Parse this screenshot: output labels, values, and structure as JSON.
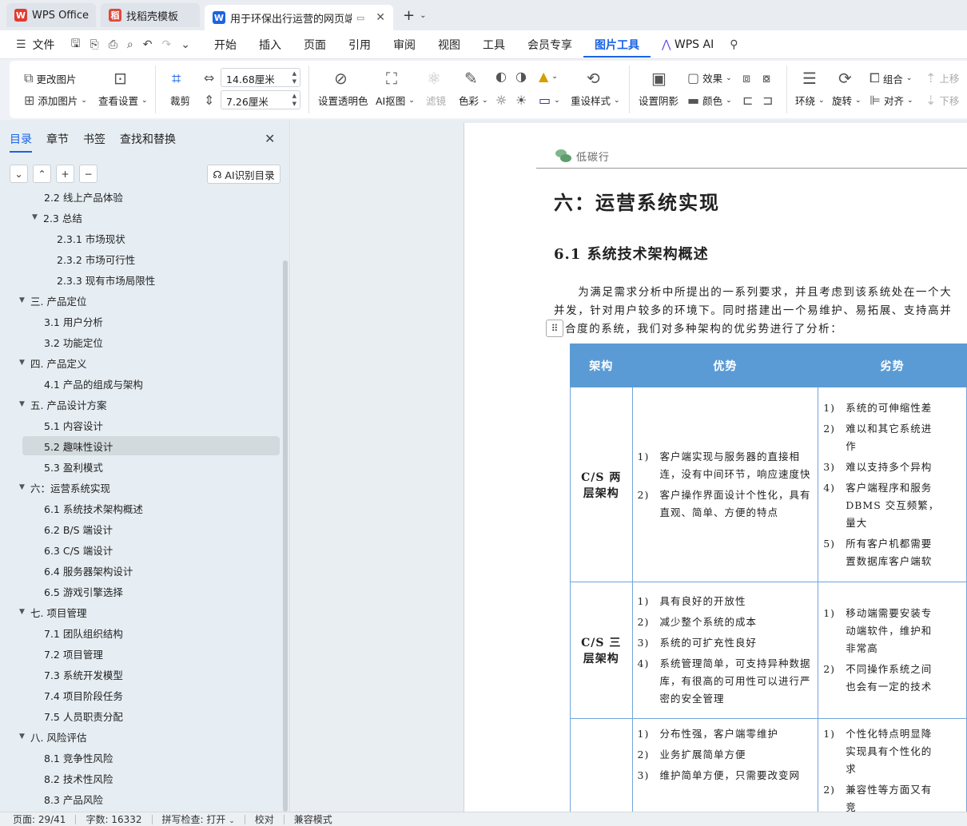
{
  "tabs": [
    {
      "label": "WPS Office",
      "logo": "W",
      "color": "#e03c31"
    },
    {
      "label": "找稻壳模板",
      "logo": "稻",
      "color": "#e0483a"
    },
    {
      "label": "用于环保出行运营的网页端系",
      "logo": "W",
      "color": "#1a63e6"
    }
  ],
  "menu": {
    "file": "文件",
    "items": [
      "开始",
      "插入",
      "页面",
      "引用",
      "审阅",
      "视图",
      "工具",
      "会员专享"
    ],
    "active": "图片工具",
    "ai": "WPS AI"
  },
  "ribbon": {
    "change_image": "更改图片",
    "add_image": "添加图片",
    "view_settings": "查看设置",
    "crop": "裁剪",
    "width": "14.68厘米",
    "height": "7.26厘米",
    "set_transparent": "设置透明色",
    "ai_cutout": "AI抠图",
    "filter": "滤镜",
    "color": "色彩",
    "reset_style": "重设样式",
    "set_shadow": "设置阴影",
    "effect": "效果",
    "fill_color": "颜色",
    "wrap": "环绕",
    "rotate": "旋转",
    "group": "组合",
    "align": "对齐",
    "move_up": "上移",
    "move_down": "下移"
  },
  "sidebar": {
    "tabs": [
      "目录",
      "章节",
      "书签",
      "查找和替换"
    ],
    "ai_button": "AI识别目录",
    "toc": [
      {
        "label": "2.2  线上产品体验",
        "level": 2,
        "arrow": false
      },
      {
        "label": "2.3  总结",
        "level": 2,
        "arrow": true
      },
      {
        "label": "2.3.1  市场现状",
        "level": 3,
        "arrow": false
      },
      {
        "label": "2.3.2  市场可行性",
        "level": 3,
        "arrow": false
      },
      {
        "label": "2.3.3  现有市场局限性",
        "level": 3,
        "arrow": false
      },
      {
        "label": "三. 产品定位",
        "level": 1,
        "arrow": true
      },
      {
        "label": "3.1  用户分析",
        "level": 2,
        "arrow": false
      },
      {
        "label": "3.2  功能定位",
        "level": 2,
        "arrow": false
      },
      {
        "label": "四. 产品定义",
        "level": 1,
        "arrow": true
      },
      {
        "label": "4.1  产品的组成与架构",
        "level": 2,
        "arrow": false
      },
      {
        "label": "五. 产品设计方案",
        "level": 1,
        "arrow": true
      },
      {
        "label": "5.1 内容设计",
        "level": 2,
        "arrow": false
      },
      {
        "label": "5.2  趣味性设计",
        "level": 2,
        "arrow": false,
        "selected": true
      },
      {
        "label": "5.3  盈利模式",
        "level": 2,
        "arrow": false
      },
      {
        "label": "六：运营系统实现",
        "level": 1,
        "arrow": true
      },
      {
        "label": "6.1  系统技术架构概述",
        "level": 2,
        "arrow": false
      },
      {
        "label": "6.2 B/S 端设计",
        "level": 2,
        "arrow": false
      },
      {
        "label": "6.3 C/S 端设计",
        "level": 2,
        "arrow": false
      },
      {
        "label": "6.4 服务器架构设计",
        "level": 2,
        "arrow": false
      },
      {
        "label": "6.5 游戏引擎选择",
        "level": 2,
        "arrow": false
      },
      {
        "label": "七. 项目管理",
        "level": 1,
        "arrow": true
      },
      {
        "label": "7.1  团队组织结构",
        "level": 2,
        "arrow": false
      },
      {
        "label": "7.2  项目管理",
        "level": 2,
        "arrow": false
      },
      {
        "label": "7.3  系统开发模型",
        "level": 2,
        "arrow": false
      },
      {
        "label": "7.4  项目阶段任务",
        "level": 2,
        "arrow": false
      },
      {
        "label": "7.5  人员职责分配",
        "level": 2,
        "arrow": false
      },
      {
        "label": "八. 风险评估",
        "level": 1,
        "arrow": true
      },
      {
        "label": "8.1  竞争性风险",
        "level": 2,
        "arrow": false
      },
      {
        "label": "8.2  技术性风险",
        "level": 2,
        "arrow": false
      },
      {
        "label": "8.3  产品风险",
        "level": 2,
        "arrow": false
      }
    ]
  },
  "doc": {
    "header": "低碳行",
    "h1": "六：运营系统实现",
    "h2": "6.1  系统技术架构概述",
    "para": [
      "　　为满足需求分析中所提出的一系列要求，并且考虑到该系统处在一个大",
      "并发，针对用户较多的环境下。同时搭建出一个易维护、易拓展、支持高并",
      "合度的系统，我们对多种架构的优劣势进行了分析："
    ],
    "table": {
      "headers": [
        "架构",
        "优势",
        "劣势"
      ],
      "rows": [
        {
          "name": "C/S 两层架构",
          "pros": [
            [
              "1)",
              "客户端实现与服务器的直接相"
            ],
            [
              "",
              "连，没有中间环节，响应速度快"
            ],
            [
              "2)",
              "客户操作界面设计个性化，具有"
            ],
            [
              "",
              "直观、简单、方便的特点"
            ]
          ],
          "cons": [
            [
              "1)",
              "系统的可伸缩性差"
            ],
            [
              "2)",
              "难以和其它系统进"
            ],
            [
              "",
              "作"
            ],
            [
              "3)",
              "难以支持多个异构"
            ],
            [
              "4)",
              "客户端程序和服务"
            ],
            [
              "",
              "DBMS 交互频繁，"
            ],
            [
              "",
              "量大"
            ],
            [
              "5)",
              "所有客户机都需要"
            ],
            [
              "",
              "置数据库客户端软"
            ]
          ]
        },
        {
          "name": "C/S 三层架构",
          "pros": [
            [
              "1)",
              "具有良好的开放性"
            ],
            [
              "2)",
              "减少整个系统的成本"
            ],
            [
              "3)",
              "系统的可扩充性良好"
            ],
            [
              "4)",
              "系统管理简单，可支持异种数据"
            ],
            [
              "",
              "库，有很高的可用性可以进行严"
            ],
            [
              "",
              "密的安全管理"
            ]
          ],
          "cons": [
            [
              "1)",
              "移动端需要安装专"
            ],
            [
              "",
              "动端软件，维护和"
            ],
            [
              "",
              "非常高"
            ],
            [
              "2)",
              "不同操作系统之间"
            ],
            [
              "",
              "也会有一定的技术"
            ]
          ]
        },
        {
          "name": "",
          "pros": [
            [
              "1)",
              "分布性强，客户端零维护"
            ],
            [
              "2)",
              "业务扩展简单方便"
            ],
            [
              "3)",
              "维护简单方便，只需要改变网"
            ]
          ],
          "cons": [
            [
              "1)",
              "个性化特点明显降"
            ],
            [
              "",
              "实现具有个性化的"
            ],
            [
              "",
              "求"
            ],
            [
              "2)",
              "兼容性等方面又有"
            ],
            [
              "",
              "竞"
            ]
          ]
        }
      ]
    }
  },
  "status": {
    "page": "页面: 29/41",
    "words": "字数: 16332",
    "spell": "拼写检查: 打开",
    "proof": "校对",
    "compat": "兼容模式"
  }
}
